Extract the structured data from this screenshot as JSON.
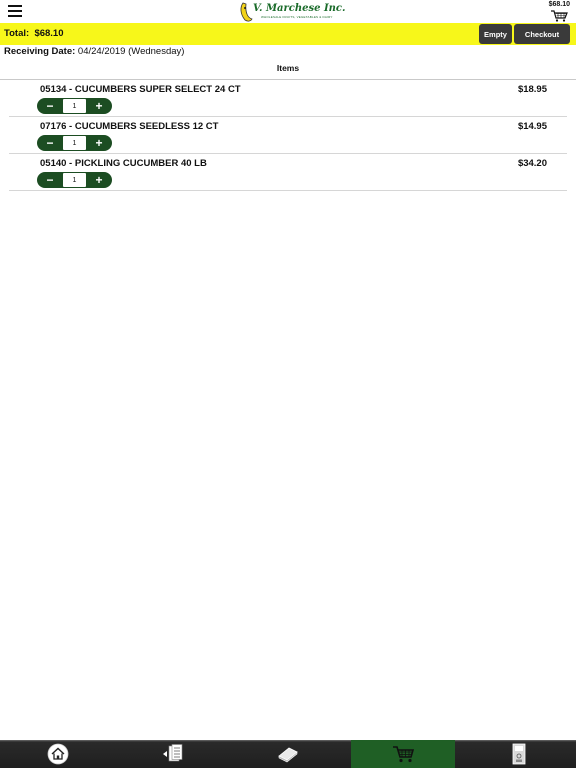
{
  "header": {
    "logo_text": "V. Marchese Inc.",
    "logo_subtext": "WHOLESALE FRUITS, VEGETABLES & DAIRY",
    "cart_total": "$68.10"
  },
  "total_bar": {
    "total_label": "Total:",
    "total_value": "$68.10",
    "empty_label": "Empty",
    "checkout_label": "Checkout"
  },
  "receiving": {
    "label": "Receiving Date:",
    "value": "04/24/2019 (Wednesday)"
  },
  "items_heading": "Items",
  "items": [
    {
      "name": "05134 - CUCUMBERS SUPER SELECT 24 CT",
      "price": "$18.95",
      "qty": "1"
    },
    {
      "name": "07176 - CUCUMBERS SEEDLESS 12 CT",
      "price": "$14.95",
      "qty": "1"
    },
    {
      "name": "05140 - PICKLING CUCUMBER 40 LB",
      "price": "$34.20",
      "qty": "1"
    }
  ],
  "bottom_nav": [
    {
      "icon": "home-icon"
    },
    {
      "icon": "order-list-icon"
    },
    {
      "icon": "catalog-book-icon"
    },
    {
      "icon": "cart-icon",
      "active": true
    },
    {
      "icon": "calculator-icon"
    }
  ],
  "colors": {
    "total_bar": "#f7f71a",
    "stepper": "#1c4d22",
    "active_tab": "#1f5f25",
    "button_dark": "#3a3a3a"
  }
}
